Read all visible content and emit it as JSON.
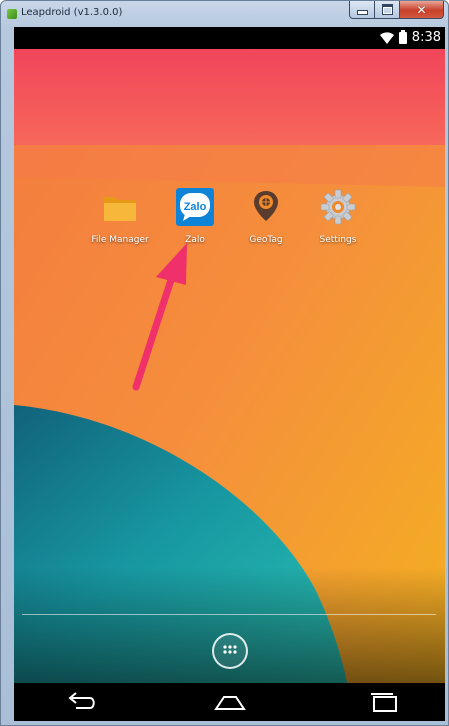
{
  "window": {
    "title": "Leapdroid (v1.3.0.0)",
    "controls": {
      "minimize": "minimize",
      "maximize": "maximize",
      "close": "✕"
    }
  },
  "statusbar": {
    "time": "8:38",
    "icons": [
      "wifi-icon",
      "battery-icon"
    ]
  },
  "apps": [
    {
      "label": "File Manager",
      "icon": "folder-icon"
    },
    {
      "label": "Zalo",
      "icon": "zalo-icon",
      "icon_text": "Zalo"
    },
    {
      "label": "GeoTag",
      "icon": "location-pin-icon"
    },
    {
      "label": "Settings",
      "icon": "gear-icon"
    }
  ],
  "annotation": {
    "icon": "arrow-icon",
    "color": "#f0306a",
    "points_to": "Zalo"
  },
  "dock": {
    "all_apps": "all-apps-icon"
  },
  "navbar": {
    "buttons": [
      "back-icon",
      "home-icon",
      "recents-icon"
    ]
  },
  "colors": {
    "wallpaper_top": "#f35a5c",
    "wallpaper_orange": "#f58a3e",
    "wallpaper_yellow": "#f4b32a",
    "wallpaper_teal": "#1ea6a3",
    "zalo_blue": "#0f84d6"
  }
}
